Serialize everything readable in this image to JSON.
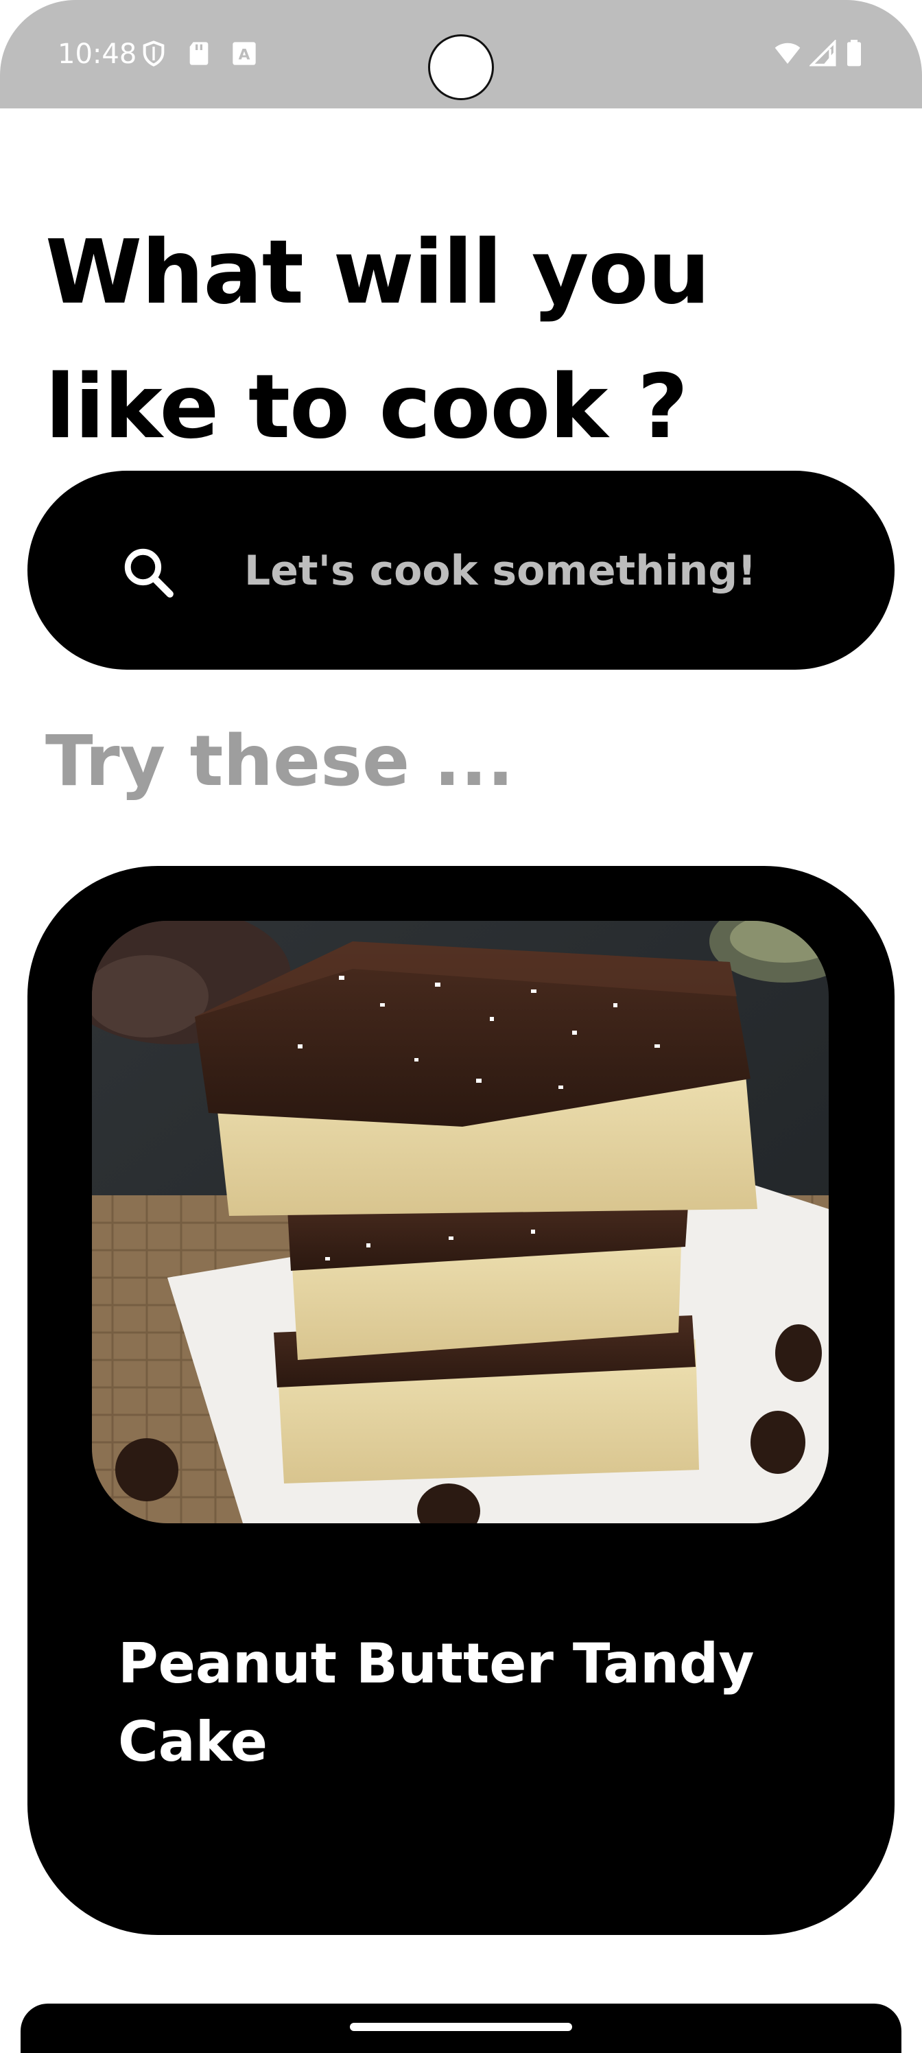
{
  "status_bar": {
    "time": "10:48",
    "left_icons": [
      "shield-icon",
      "sd-card-icon",
      "keyboard-a-icon"
    ],
    "right_icons": [
      "wifi-icon",
      "signal-icon",
      "battery-icon"
    ]
  },
  "header": {
    "title": "What will you like to cook ?"
  },
  "search": {
    "placeholder": "Let's cook something!",
    "value": "",
    "icon": "search-icon"
  },
  "section": {
    "title": "Try these ..."
  },
  "recipes": [
    {
      "title": "Peanut Butter Tandy Cake",
      "image": "layered chocolate-topped cake bars"
    }
  ],
  "colors": {
    "background": "#ffffff",
    "card": "#000000",
    "muted_text": "#9e9e9e",
    "search_text": "#bdbdbd",
    "status_bar": "#bdbdbd"
  }
}
